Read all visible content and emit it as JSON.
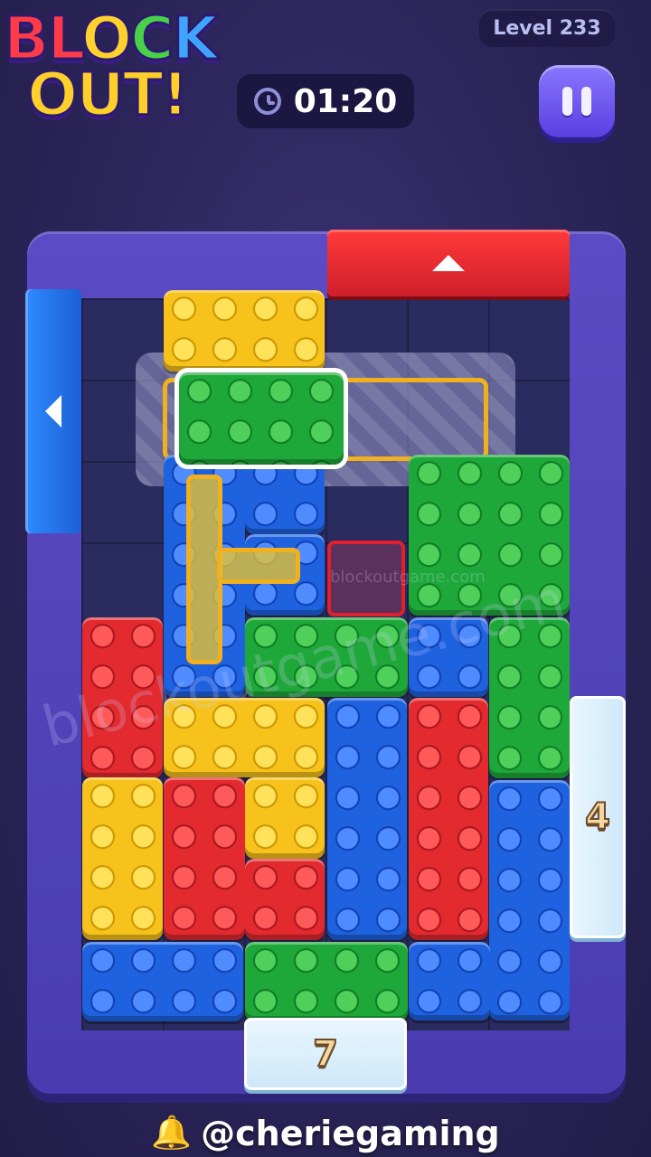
{
  "header": {
    "logo_line1": "BLOCK",
    "logo_line2": "OUT!",
    "level_label": "Level 233",
    "timer": "01:20",
    "pause_icon": "pause-icon",
    "clock_icon": "clock-icon"
  },
  "board": {
    "exit_top_color": "#e22a2f",
    "exit_left_color": "#1f62e0",
    "ice_right_count": "4",
    "ice_bottom_count": "7"
  },
  "watermark": {
    "large": "blockoutgame.com",
    "small": "blockoutgame.com"
  },
  "footer": {
    "bell_icon": "bell-icon",
    "handle": "@cheriegaming"
  }
}
